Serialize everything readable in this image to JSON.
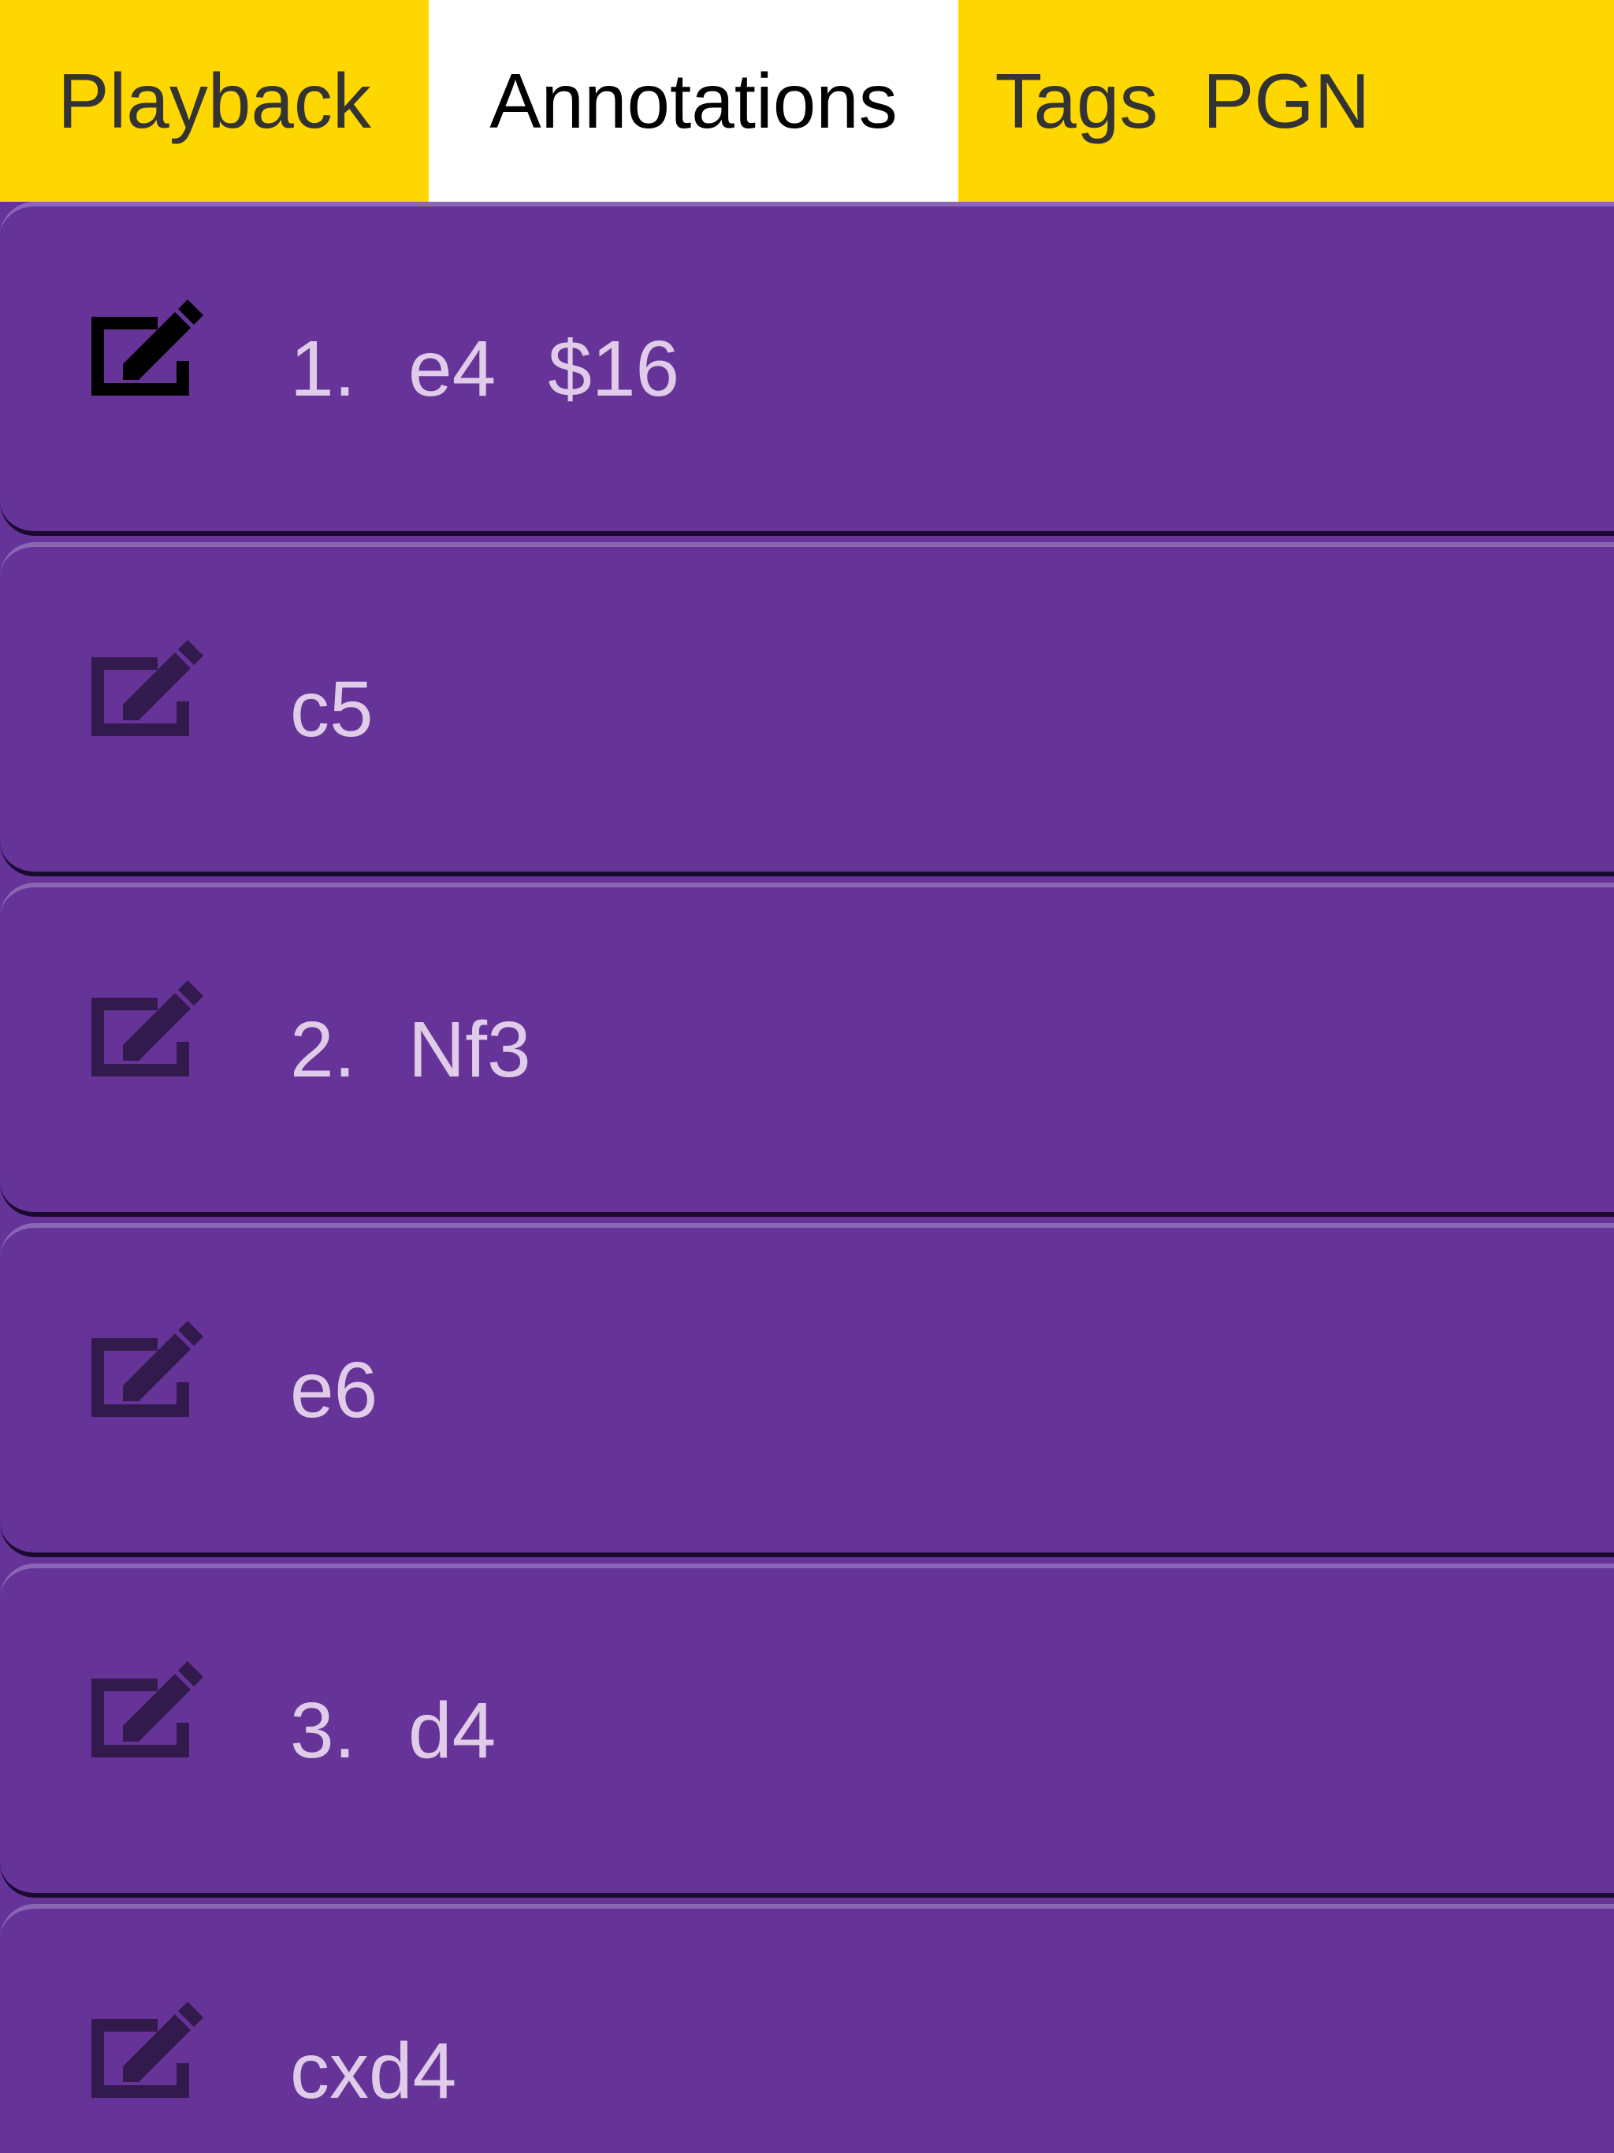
{
  "tabs": [
    {
      "label": "Playback",
      "active": false
    },
    {
      "label": "Annotations",
      "active": true
    },
    {
      "label": "Tags",
      "active": false
    },
    {
      "label": "PGN",
      "active": false
    }
  ],
  "moves": [
    {
      "number": "1.",
      "san": "e4",
      "nag": "$16",
      "icon": "edit-icon",
      "selected": true
    },
    {
      "number": "",
      "san": "c5",
      "nag": "",
      "icon": "edit-icon",
      "selected": false
    },
    {
      "number": "2.",
      "san": "Nf3",
      "nag": "",
      "icon": "edit-icon",
      "selected": false
    },
    {
      "number": "",
      "san": "e6",
      "nag": "",
      "icon": "edit-icon",
      "selected": false
    },
    {
      "number": "3.",
      "san": "d4",
      "nag": "",
      "icon": "edit-icon",
      "selected": false
    },
    {
      "number": "",
      "san": "cxd4",
      "nag": "",
      "icon": "edit-icon",
      "selected": false
    }
  ],
  "colors": {
    "tab_bar": "#FFD700",
    "tab_active": "#FFFFFF",
    "row_background": "#663399",
    "move_text": "#E0CCE8",
    "icon_selected": "#000000",
    "icon_default": "#331A4D"
  }
}
